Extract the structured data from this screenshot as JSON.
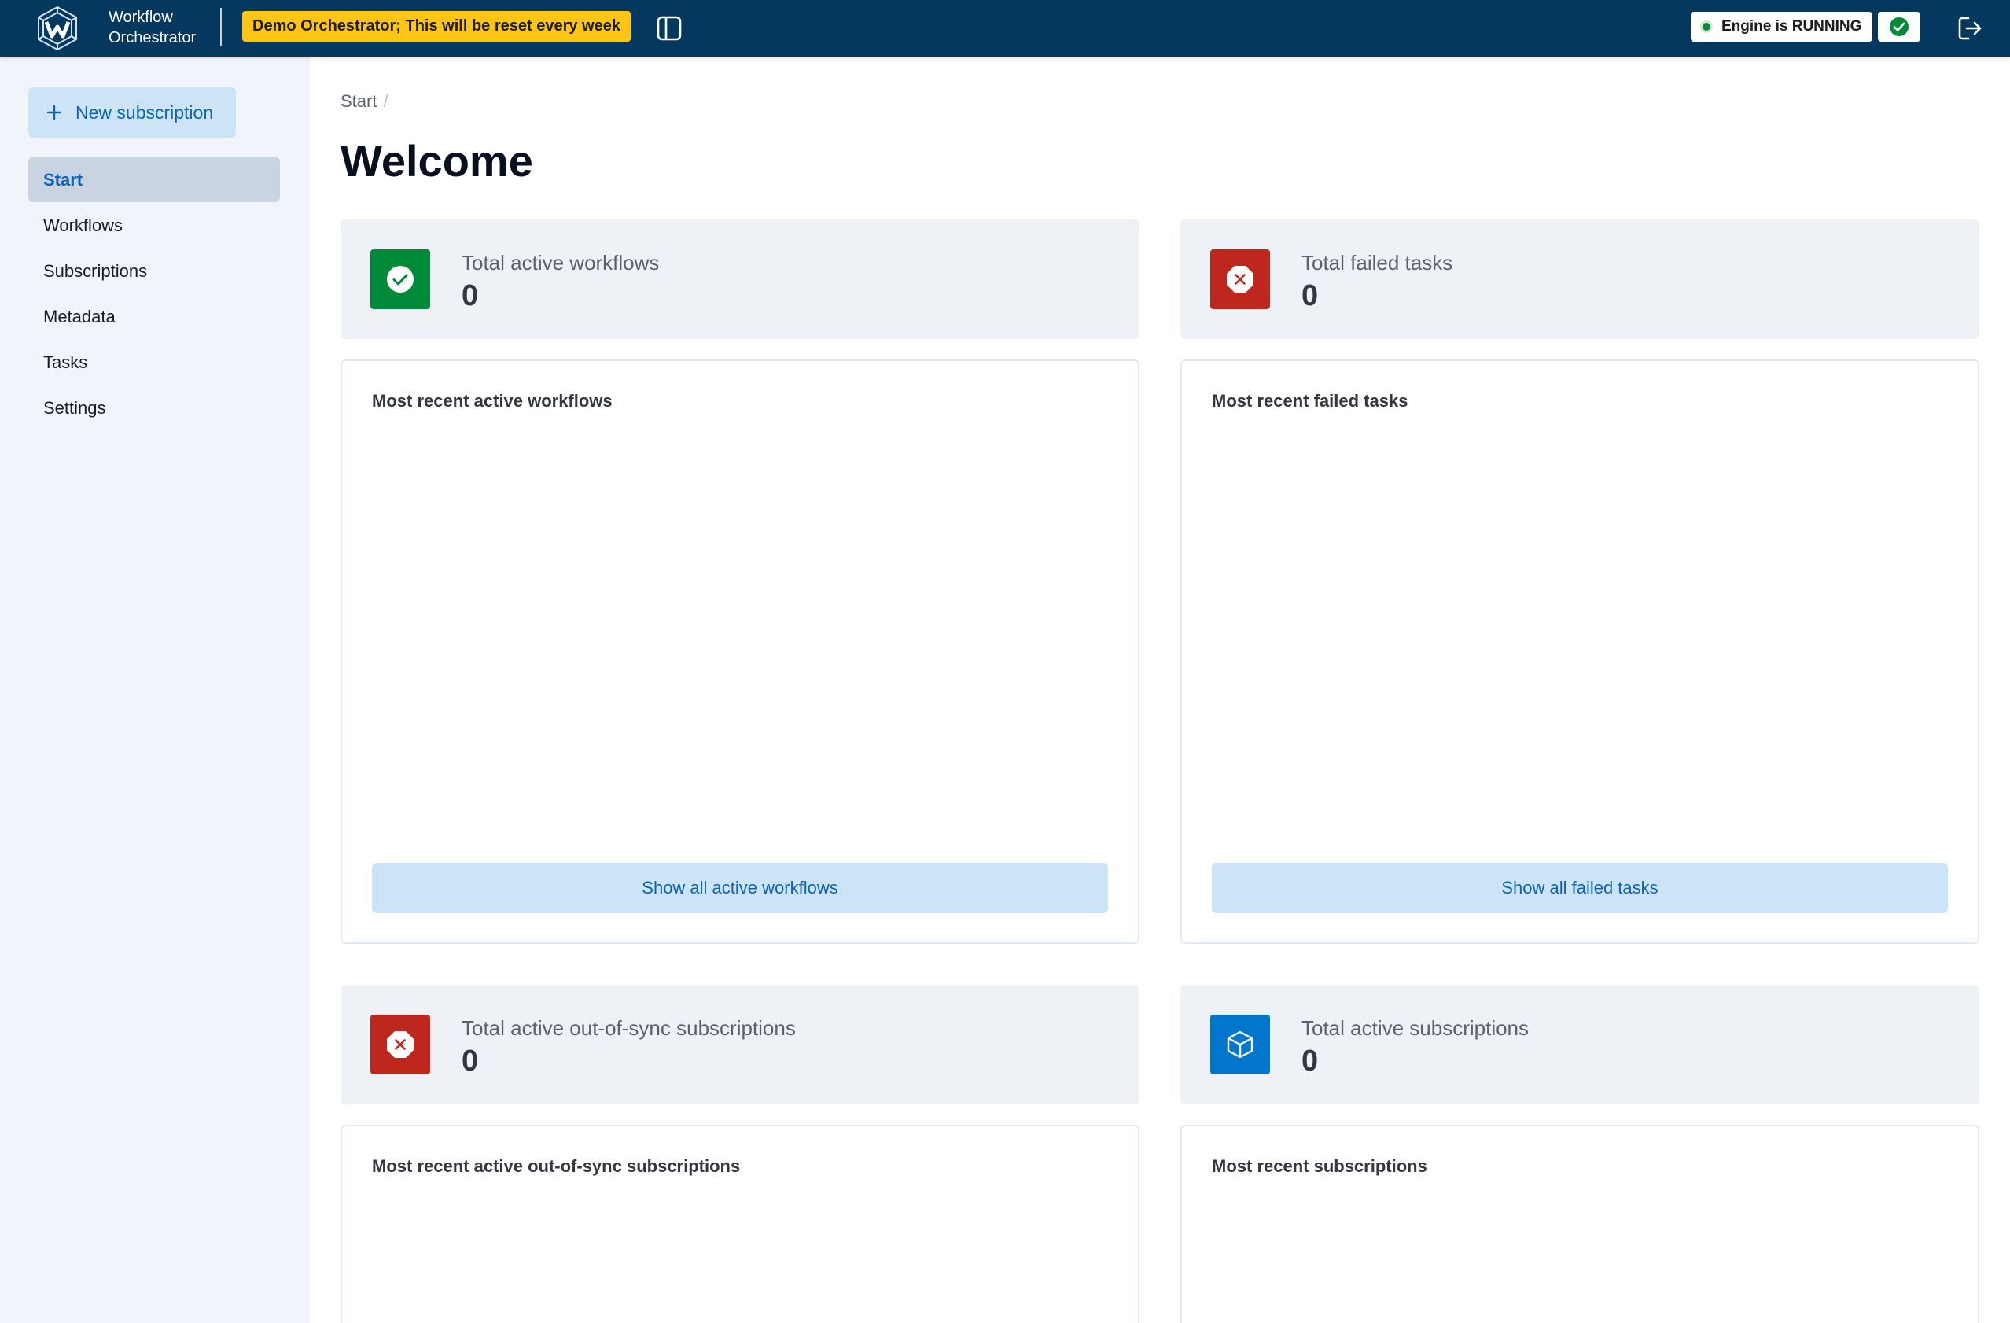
{
  "header": {
    "app_name_line1": "Workflow",
    "app_name_line2": "Orchestrator",
    "demo_badge": "Demo Orchestrator; This will be reset every week",
    "engine_status": "Engine is RUNNING",
    "icons": {
      "logo": "orchestrator-logo",
      "sidebar_toggle": "sidebar-toggle-icon",
      "engine_ok": "check-circle-icon",
      "logout": "logout-icon"
    }
  },
  "sidebar": {
    "new_subscription_label": "New subscription",
    "items": [
      {
        "label": "Start",
        "active": true
      },
      {
        "label": "Workflows",
        "active": false
      },
      {
        "label": "Subscriptions",
        "active": false
      },
      {
        "label": "Metadata",
        "active": false
      },
      {
        "label": "Tasks",
        "active": false
      },
      {
        "label": "Settings",
        "active": false
      }
    ]
  },
  "main": {
    "breadcrumb": [
      "Start"
    ],
    "title": "Welcome",
    "stats": [
      {
        "label": "Total active workflows",
        "value": "0",
        "icon": "check-circle-icon",
        "color": "#008939"
      },
      {
        "label": "Total failed tasks",
        "value": "0",
        "icon": "error-icon",
        "color": "#bd271e"
      },
      {
        "label": "Total active out-of-sync subscriptions",
        "value": "0",
        "icon": "error-icon",
        "color": "#bd271e"
      },
      {
        "label": "Total active subscriptions",
        "value": "0",
        "icon": "cube-icon",
        "color": "#0077cc"
      }
    ],
    "lists": [
      {
        "title": "Most recent active workflows",
        "button": "Show all active workflows"
      },
      {
        "title": "Most recent failed tasks",
        "button": "Show all failed tasks"
      },
      {
        "title": "Most recent active out-of-sync subscriptions"
      },
      {
        "title": "Most recent subscriptions"
      }
    ]
  },
  "colors": {
    "header_bg": "#04385f",
    "badge_bg": "#fec514",
    "accent": "#0b64b8",
    "success": "#008939",
    "danger": "#bd271e",
    "primary": "#0077cc"
  }
}
